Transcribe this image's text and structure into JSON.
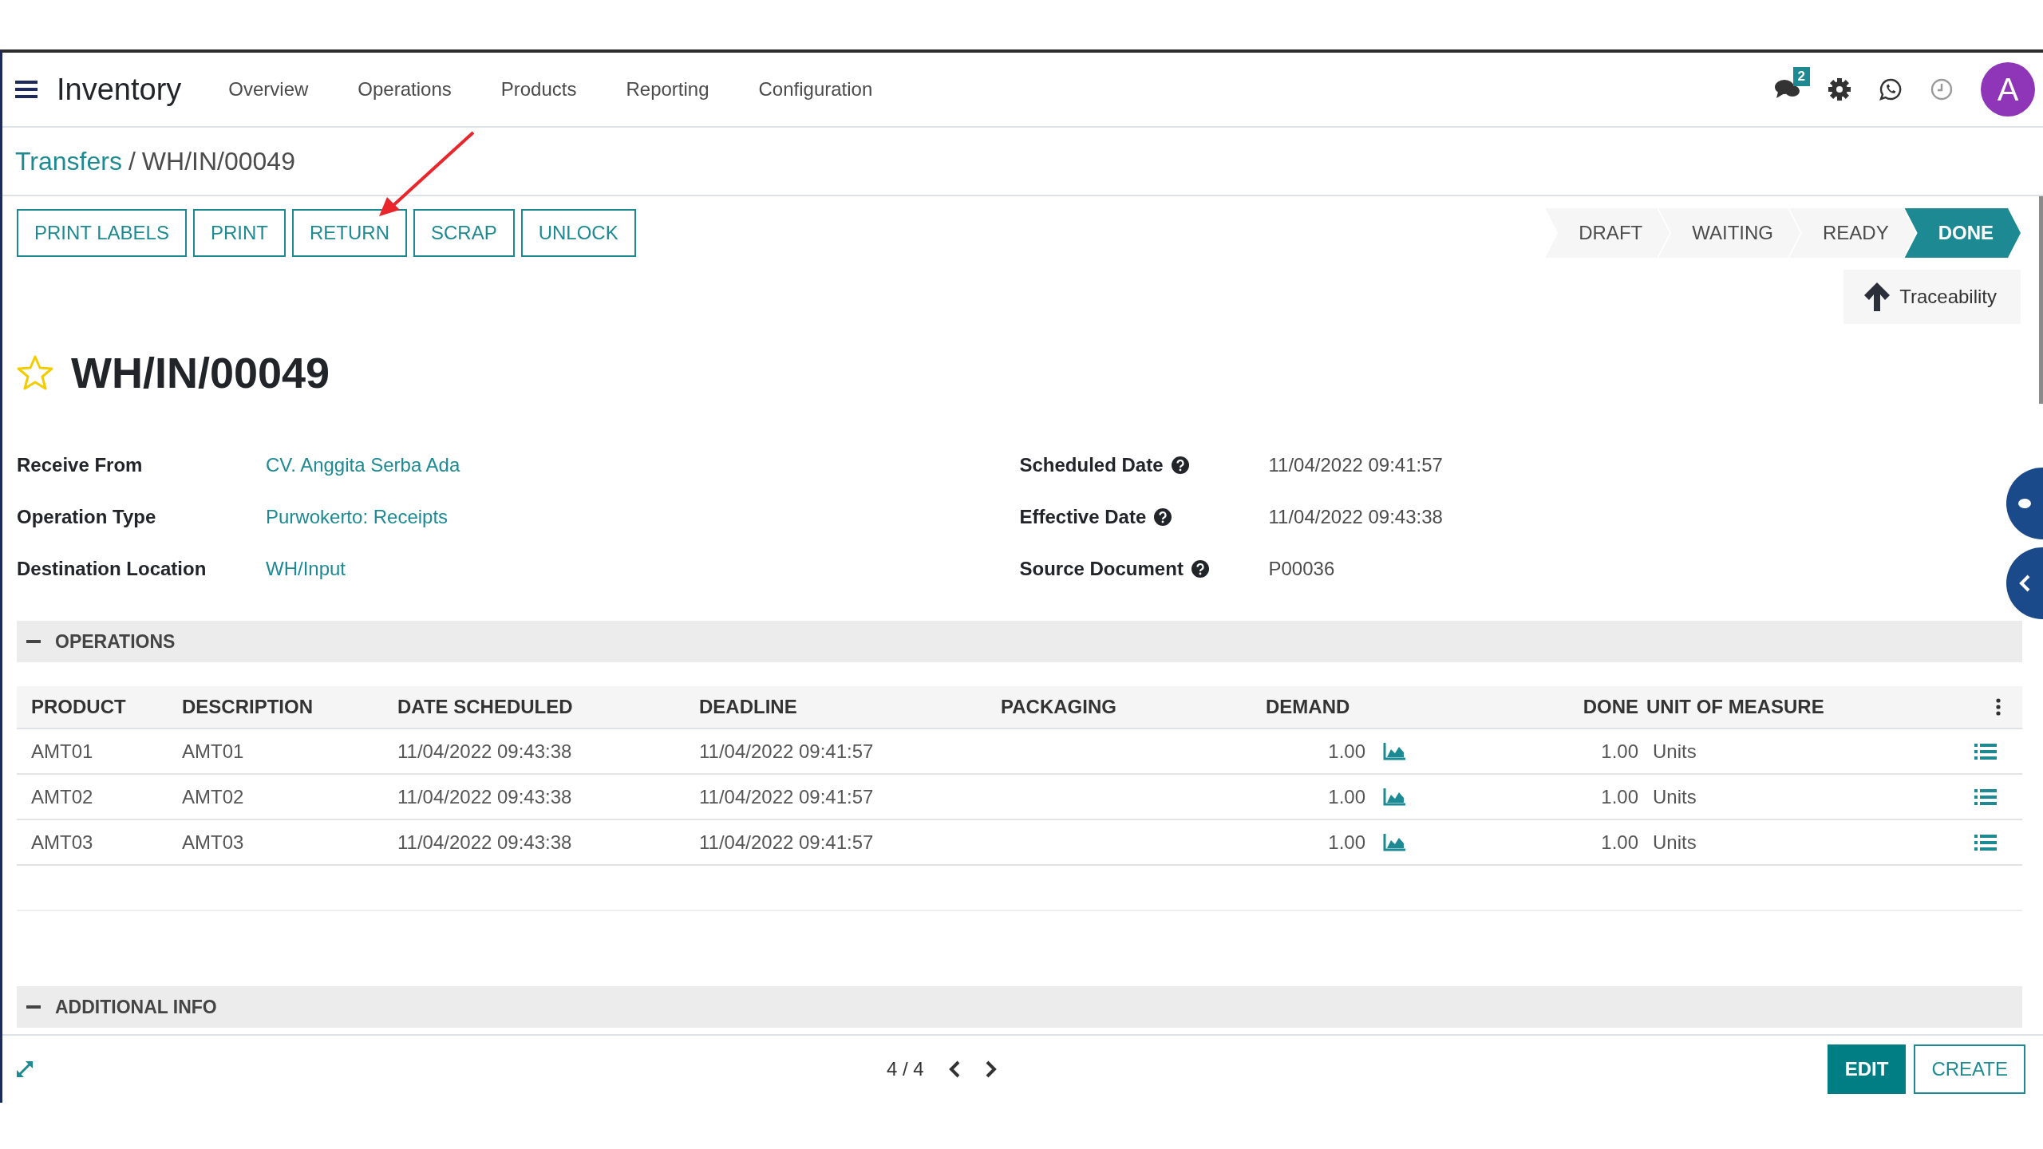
{
  "app": {
    "title": "Inventory",
    "menu": [
      "Overview",
      "Operations",
      "Products",
      "Reporting",
      "Configuration"
    ],
    "message_count": "2",
    "avatar": "A"
  },
  "breadcrumb": {
    "parent": "Transfers",
    "separator": "/",
    "current": "WH/IN/00049"
  },
  "actions": [
    "PRINT LABELS",
    "PRINT",
    "RETURN",
    "SCRAP",
    "UNLOCK"
  ],
  "status": [
    {
      "label": "DRAFT",
      "selected": false
    },
    {
      "label": "WAITING",
      "selected": false
    },
    {
      "label": "READY",
      "selected": false
    },
    {
      "label": "DONE",
      "selected": true
    }
  ],
  "smart_button": {
    "label": "Traceability"
  },
  "record": {
    "title": "WH/IN/00049",
    "starred": false
  },
  "fields_left": [
    {
      "label": "Receive From",
      "value": "CV. Anggita Serba Ada",
      "kind": "link"
    },
    {
      "label": "Operation Type",
      "value": "Purwokerto: Receipts",
      "kind": "link"
    },
    {
      "label": "Destination Location",
      "value": "WH/Input",
      "kind": "link"
    }
  ],
  "fields_right": [
    {
      "label": "Scheduled Date",
      "value": "11/04/2022 09:41:57",
      "help": true
    },
    {
      "label": "Effective Date",
      "value": "11/04/2022 09:43:38",
      "help": true
    },
    {
      "label": "Source Document",
      "value": "P00036",
      "help": true
    }
  ],
  "operations": {
    "title": "OPERATIONS",
    "expanded": true,
    "columns": [
      "PRODUCT",
      "DESCRIPTION",
      "DATE SCHEDULED",
      "DEADLINE",
      "PACKAGING",
      "DEMAND",
      "DONE",
      "UNIT OF MEASURE"
    ],
    "rows": [
      {
        "product": "AMT01",
        "description": "AMT01",
        "date_scheduled": "11/04/2022 09:43:38",
        "deadline": "11/04/2022 09:41:57",
        "demand": "1.00",
        "done": "1.00",
        "unit": "Units"
      },
      {
        "product": "AMT02",
        "description": "AMT02",
        "date_scheduled": "11/04/2022 09:43:38",
        "deadline": "11/04/2022 09:41:57",
        "demand": "1.00",
        "done": "1.00",
        "unit": "Units"
      },
      {
        "product": "AMT03",
        "description": "AMT03",
        "date_scheduled": "11/04/2022 09:43:38",
        "deadline": "11/04/2022 09:41:57",
        "demand": "1.00",
        "done": "1.00",
        "unit": "Units"
      }
    ]
  },
  "additional_info": {
    "title": "ADDITIONAL INFO",
    "expanded": true
  },
  "pager": "4 / 4",
  "buttons": [
    {
      "label": "EDIT",
      "kind": "primary"
    },
    {
      "label": "CREATE",
      "kind": "secondary"
    }
  ]
}
